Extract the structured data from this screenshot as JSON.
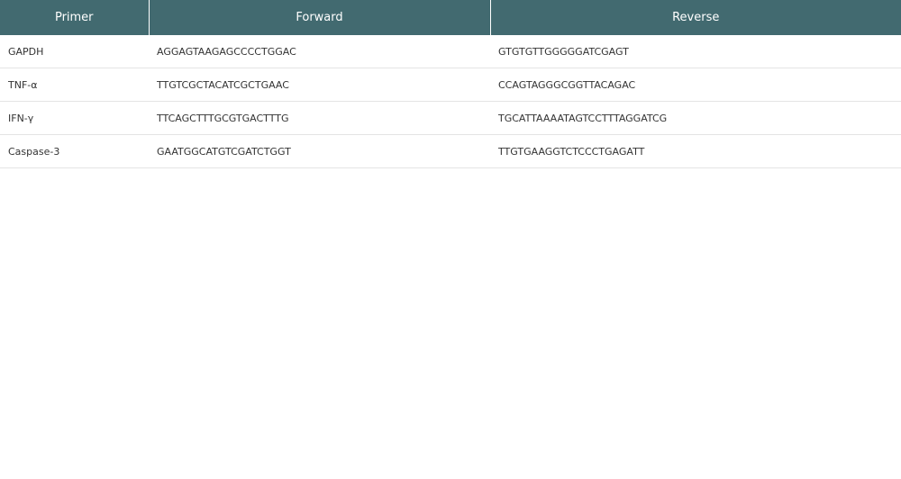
{
  "table": {
    "headers": [
      "Primer",
      "Forward",
      "Reverse"
    ],
    "rows": [
      [
        "GAPDH",
        "AGGAGTAAGAGCCCCTGGAC",
        "GTGTGTTGGGGGATCGAGT"
      ],
      [
        "TNF-α",
        "TTGTCGCTACATCGCTGAAC",
        "CCAGTAGGGCGGTTACAGAC"
      ],
      [
        "IFN-γ",
        "TTCAGCTTTGCGTGACTTTG",
        "TGCATTAAAATAGTCCTTTAGGATCG"
      ],
      [
        "Caspase-3",
        "GAATGGCATGTCGATCTGGT",
        "TTGTGAAGGTCTCCCTGAGATT"
      ]
    ]
  },
  "colors": {
    "header_bg": "#426a70",
    "header_text": "#ffffff",
    "row_border": "#e4e4e4"
  }
}
